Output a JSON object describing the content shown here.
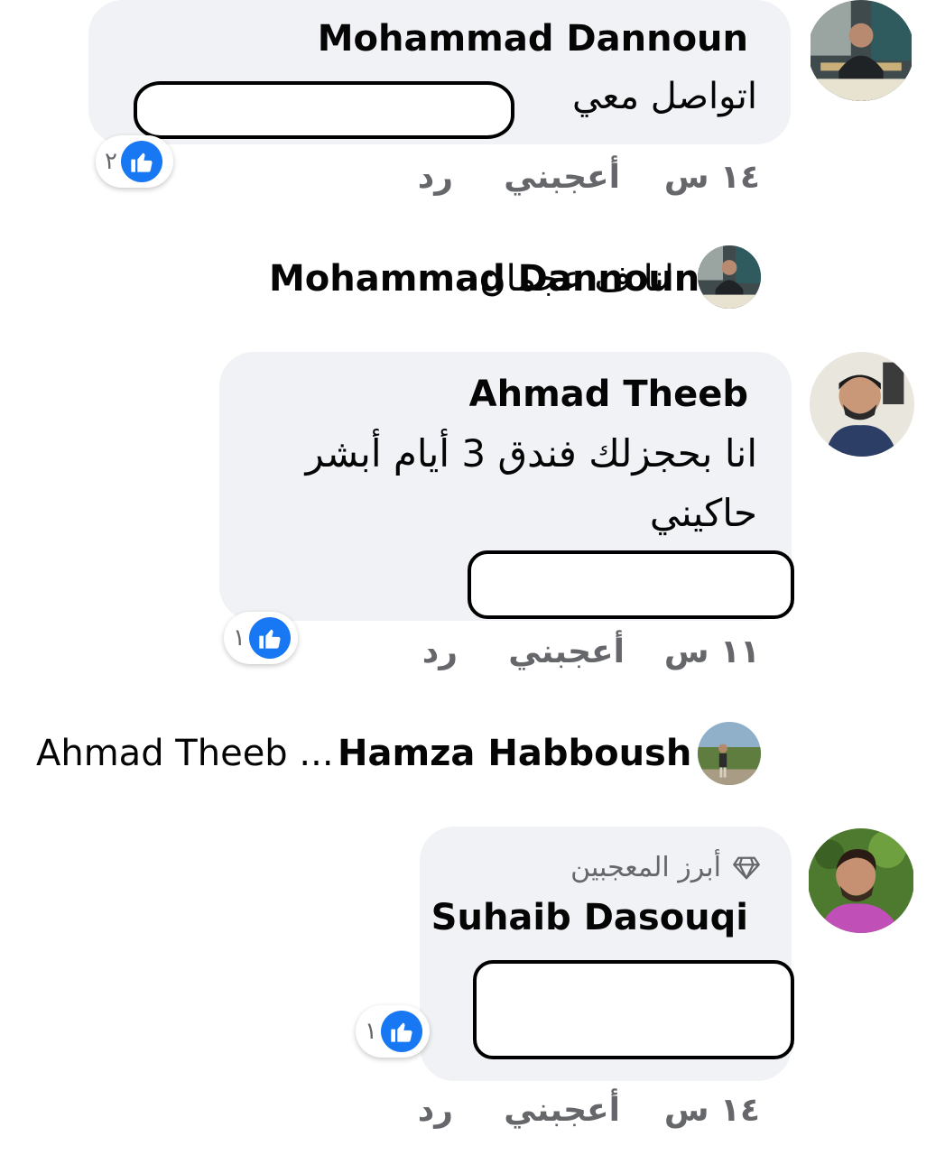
{
  "comments": [
    {
      "author": "Mohammad Dannoun",
      "text": "اتواصل معي",
      "time": "١٤ س",
      "like_label": "أعجبني",
      "reply_label": "رد",
      "reaction_count": "٢",
      "avatar_icon": "man-in-studio-avatar"
    },
    {
      "author": "Ahmad Theeb",
      "text_line1": "انا بحجزلك فندق 3 أيام أبشر",
      "text_line2": "حاكيني",
      "time": "١١ س",
      "like_label": "أعجبني",
      "reply_label": "رد",
      "reaction_count": "١",
      "avatar_icon": "young-man-avatar"
    },
    {
      "badge_label": "أبرز المعجبين",
      "author": "Suhaib Dasouqi",
      "time": "١٤ س",
      "like_label": "أعجبني",
      "reply_label": "رد",
      "reaction_count": "١",
      "avatar_icon": "smiling-man-avatar"
    }
  ],
  "replies": [
    {
      "author": "Mohammad Dannoun",
      "text": "انا ف عجمان",
      "avatar_icon": "man-in-studio-avatar"
    },
    {
      "author": "Hamza Habboush",
      "text": "Ahmad Theeb ...",
      "avatar_icon": "man-in-park-avatar"
    }
  ],
  "colors": {
    "bubble": "#f0f2f5",
    "like_blue": "#1877f2",
    "meta_gray": "#65676b"
  }
}
